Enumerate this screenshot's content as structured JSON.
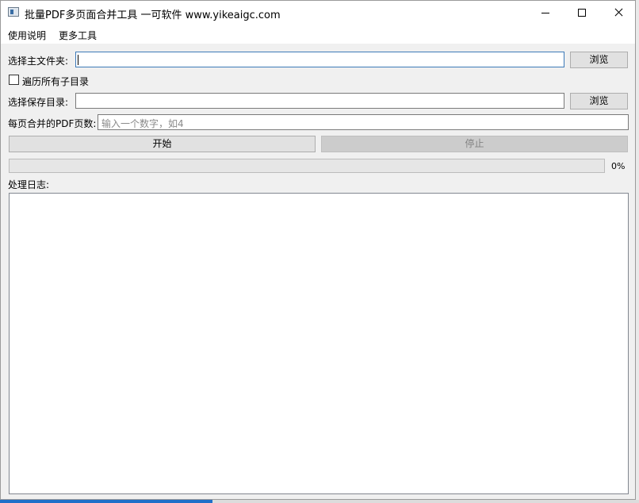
{
  "window": {
    "title": "批量PDF多页面合并工具 一可软件 www.yikeaigc.com"
  },
  "menu": {
    "help": "使用说明",
    "more_tools": "更多工具"
  },
  "form": {
    "main_folder_label": "选择主文件夹:",
    "main_folder_value": "",
    "browse_label": "浏览",
    "traverse_subdirs_label": "遍历所有子目录",
    "traverse_subdirs_checked": false,
    "save_dir_label": "选择保存目录:",
    "save_dir_value": "",
    "pages_per_sheet_label": "每页合并的PDF页数:",
    "pages_per_sheet_placeholder": "输入一个数字，如4",
    "start_label": "开始",
    "stop_label": "停止"
  },
  "progress": {
    "value": 0,
    "text": "0%"
  },
  "log": {
    "label": "处理日志:",
    "content": ""
  }
}
